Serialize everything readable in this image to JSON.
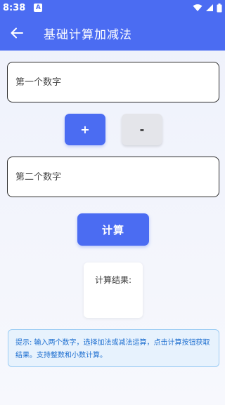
{
  "status_bar": {
    "time": "8:38",
    "notification_glyph": "A",
    "icons": [
      "wifi-icon",
      "signal-icon",
      "battery-icon"
    ]
  },
  "app_bar": {
    "title": "基础计算加减法"
  },
  "inputs": {
    "first_placeholder": "第一个数字",
    "first_value": "",
    "second_placeholder": "第二个数字",
    "second_value": ""
  },
  "operators": {
    "plus_label": "+",
    "minus_label": "-"
  },
  "calculate_label": "计算",
  "result": {
    "label": "计算结果:"
  },
  "hint": {
    "text": "提示: 输入两个数字，选择加法或减法运算，点击计算按钮获取结果。支持整数和小数计算。"
  },
  "colors": {
    "primary": "#4b6cf2",
    "hint_bg": "#e7f2fd",
    "hint_text": "#1e6fd0"
  }
}
